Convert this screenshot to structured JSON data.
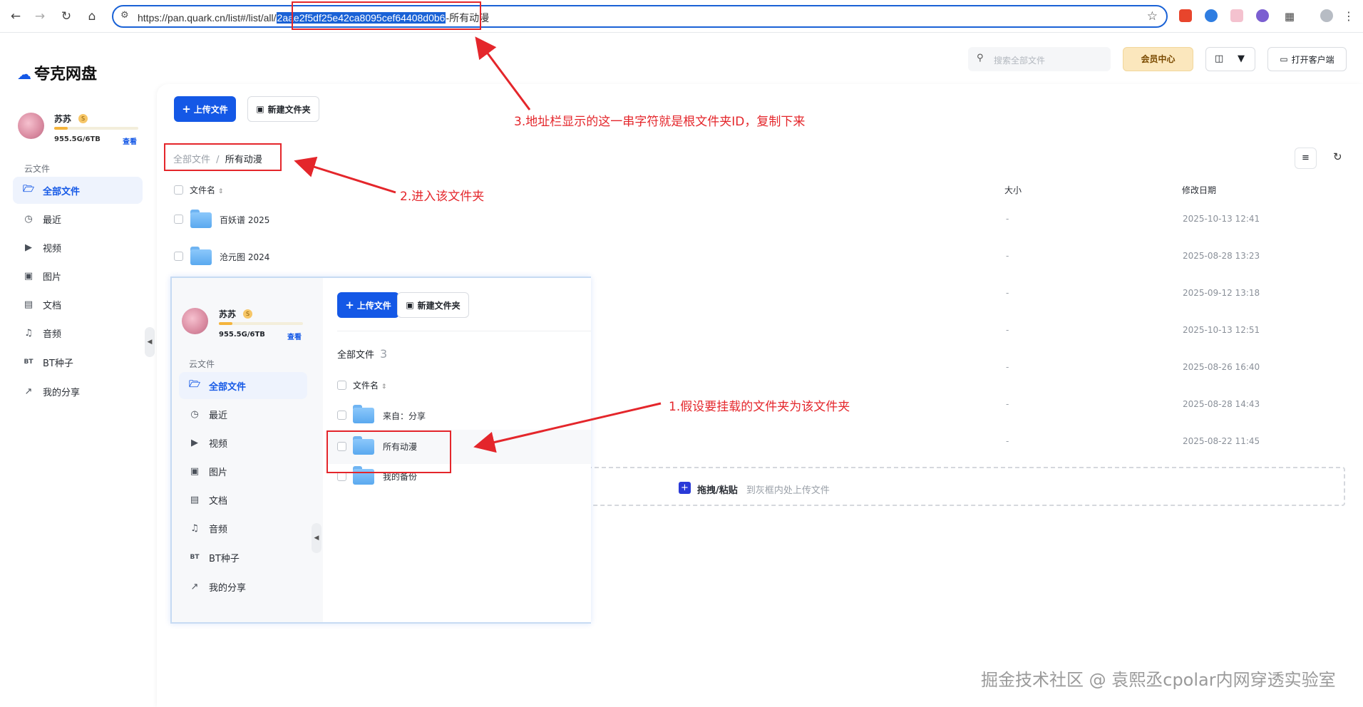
{
  "browser": {
    "url_prefix": "https://pan.quark.cn/list#/list/all/",
    "url_id": "2aae2f5df25e42ca8095cef64408d0b6",
    "url_suffix": "-所有动漫"
  },
  "app": {
    "logo": "夸克网盘",
    "search_placeholder": "搜索全部文件",
    "vip_label": "会员中心",
    "open_client_label": "打开客户端"
  },
  "user": {
    "name": "苏苏",
    "storage": "955.5G/6TB",
    "view_link": "查看"
  },
  "sidebar": {
    "section": "云文件",
    "items": [
      {
        "label": "全部文件",
        "icon": "folder-icon"
      },
      {
        "label": "最近",
        "icon": "clock-icon"
      },
      {
        "label": "视频",
        "icon": "play-icon"
      },
      {
        "label": "图片",
        "icon": "image-icon"
      },
      {
        "label": "文档",
        "icon": "doc-icon"
      },
      {
        "label": "音频",
        "icon": "headphones-icon"
      },
      {
        "label": "BT种子",
        "icon": "bt-icon"
      },
      {
        "label": "我的分享",
        "icon": "share-icon"
      }
    ]
  },
  "toolbar": {
    "upload_label": "上传文件",
    "new_folder_label": "新建文件夹"
  },
  "breadcrumb": {
    "root": "全部文件",
    "separator": "/",
    "current": "所有动漫"
  },
  "table": {
    "col_name": "文件名",
    "col_size": "大小",
    "col_date": "修改日期",
    "rows": [
      {
        "name": "百妖谱 2025",
        "size": "-",
        "date": "2025-10-13 12:41"
      },
      {
        "name": "沧元图 2024",
        "size": "-",
        "date": "2025-08-28 13:23"
      },
      {
        "name": "",
        "size": "-",
        "date": "2025-09-12 13:18"
      },
      {
        "name": "",
        "size": "-",
        "date": "2025-10-13 12:51"
      },
      {
        "name": "",
        "size": "-",
        "date": "2025-08-26 16:40"
      },
      {
        "name": "",
        "size": "-",
        "date": "2025-08-28 14:43"
      },
      {
        "name": "",
        "size": "-",
        "date": "2025-08-22 11:45"
      }
    ]
  },
  "dropzone": {
    "label": "拖拽/粘贴",
    "hint": "到灰框内处上传文件"
  },
  "inset": {
    "all_files_label": "全部文件",
    "count": "3",
    "rows": [
      {
        "name": "来自：分享"
      },
      {
        "name": "所有动漫"
      },
      {
        "name": "我的备份"
      }
    ]
  },
  "annotations": {
    "a1": "1.假设要挂载的文件夹为该文件夹",
    "a2": "2.进入该文件夹",
    "a3": "3.地址栏显示的这一串字符就是根文件夹ID，复制下来"
  },
  "watermark": "掘金技术社区 @ 袁熙丞cpolar内网穿透实验室",
  "colors": {
    "accent": "#1458e6",
    "annotation": "#e4262b"
  }
}
